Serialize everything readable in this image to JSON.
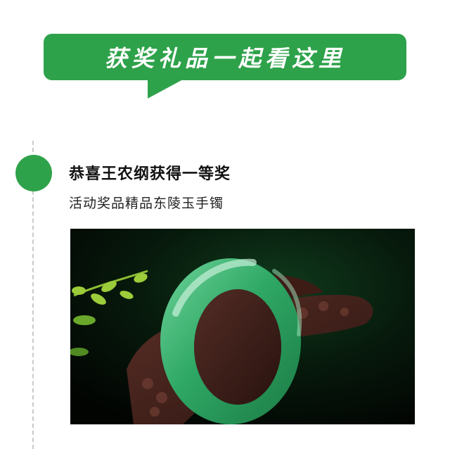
{
  "banner": {
    "text": "获奖礼品一起看这里"
  },
  "award": {
    "title": "恭喜王农纲获得一等奖",
    "subtitle": "活动奖品精品东陵玉手镯"
  },
  "colors": {
    "accent": "#2ea24a",
    "timeline": "#c9c9c9"
  },
  "photo": {
    "subject": "jade-bangle"
  }
}
